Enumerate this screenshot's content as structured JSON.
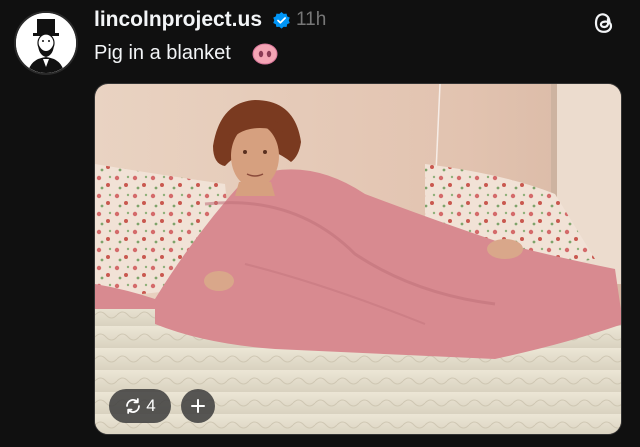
{
  "post": {
    "username": "lincolnproject.us",
    "timestamp": "11h",
    "caption": "Pig in a blanket",
    "emoji": "pig-nose",
    "verified": true
  },
  "media": {
    "repost_count": "4",
    "icons": {
      "repost": "repost-icon",
      "add": "plus-icon",
      "app": "threads-logo-icon"
    }
  },
  "colors": {
    "background": "#101010",
    "verified_badge": "#0095f6",
    "blanket": "#d88a90",
    "pig": "#f4a5b5"
  }
}
